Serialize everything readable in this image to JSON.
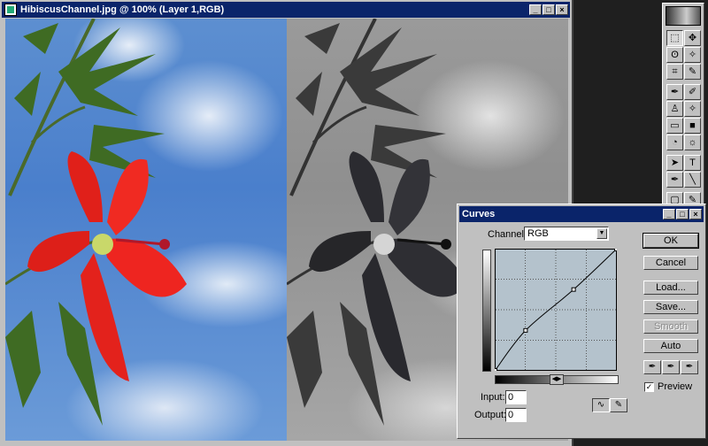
{
  "document": {
    "title": "HibiscusChannel.jpg @ 100% (Layer 1,RGB)",
    "controls": {
      "minimize": "_",
      "maximize": "□",
      "close": "×"
    }
  },
  "toolbox": {
    "tools": [
      [
        "marquee-icon",
        "move-icon"
      ],
      [
        "lasso-icon",
        "magic-wand-icon"
      ],
      [
        "crop-icon",
        "eyedropper-slice-icon"
      ],
      [
        "airbrush-icon",
        "paintbrush-icon"
      ],
      [
        "stamp-icon",
        "history-brush-icon"
      ],
      [
        "eraser-icon",
        "gradient-icon"
      ],
      [
        "blur-icon",
        "dodge-icon"
      ],
      [
        "path-select-icon",
        "type-icon"
      ],
      [
        "pen-icon",
        "line-icon"
      ],
      [
        "notes-icon",
        "eyedropper-icon"
      ],
      [
        "hand-icon",
        "zoom-icon"
      ]
    ],
    "glyphs": [
      [
        "⬚",
        "✥"
      ],
      [
        "ʘ",
        "✧"
      ],
      [
        "⌗",
        "✎"
      ],
      [
        "✒",
        "✐"
      ],
      [
        "♙",
        "✧"
      ],
      [
        "▭",
        "■"
      ],
      [
        "◔",
        "☼"
      ],
      [
        "➤",
        "T"
      ],
      [
        "✒",
        "╲"
      ],
      [
        "▢",
        "✎"
      ],
      [
        "✋",
        "🔍"
      ]
    ],
    "selected": [
      0,
      0
    ]
  },
  "curves": {
    "title": "Curves",
    "channel_label": "Channel:",
    "channel_value": "RGB",
    "buttons": {
      "ok": "OK",
      "cancel": "Cancel",
      "load": "Load...",
      "save": "Save...",
      "smooth": "Smooth",
      "auto": "Auto"
    },
    "input_label": "Input:",
    "input_value": "0",
    "output_label": "Output:",
    "output_value": "0",
    "preview_label": "Preview",
    "preview_checked": true,
    "curve_points": [
      [
        0,
        0
      ],
      [
        64,
        84
      ],
      [
        165,
        170
      ],
      [
        255,
        255
      ]
    ]
  }
}
